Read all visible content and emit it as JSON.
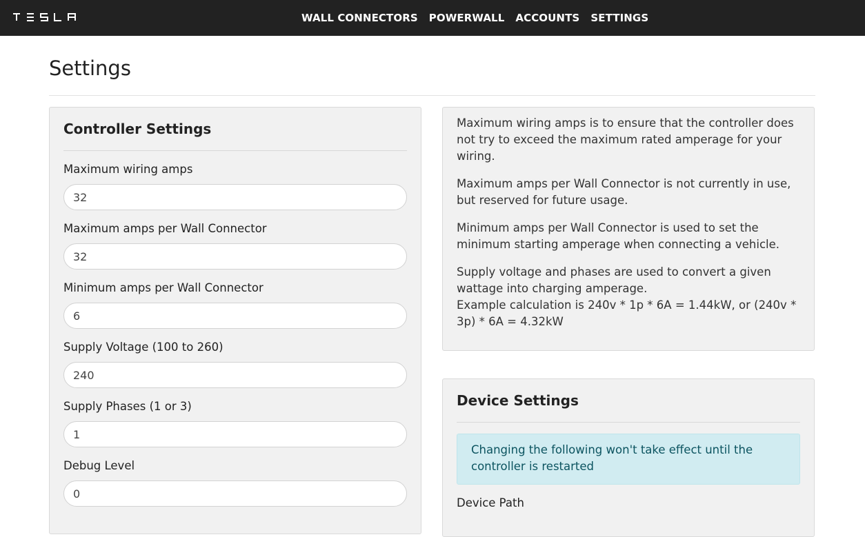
{
  "navbar": {
    "brand": "TESLA",
    "links": [
      "WALL CONNECTORS",
      "POWERWALL",
      "ACCOUNTS",
      "SETTINGS"
    ]
  },
  "page": {
    "title": "Settings"
  },
  "controller": {
    "heading": "Controller Settings",
    "fields": [
      {
        "label": "Maximum wiring amps",
        "value": "32"
      },
      {
        "label": "Maximum amps per Wall Connector",
        "value": "32"
      },
      {
        "label": "Minimum amps per Wall Connector",
        "value": "6"
      },
      {
        "label": "Supply Voltage (100 to 260)",
        "value": "240"
      },
      {
        "label": "Supply Phases (1 or 3)",
        "value": "1"
      },
      {
        "label": "Debug Level",
        "value": "0"
      }
    ]
  },
  "help": {
    "paragraphs": [
      "Maximum wiring amps is to ensure that the controller does not try to exceed the maximum rated amperage for your wiring.",
      "Maximum amps per Wall Connector is not currently in use, but reserved for future usage.",
      "Minimum amps per Wall Connector is used to set the minimum starting amperage when connecting a vehicle.",
      "Supply voltage and phases are used to convert a given wattage into charging amperage.",
      "Example calculation is 240v * 1p * 6A = 1.44kW, or (240v * 3p) * 6A = 4.32kW"
    ]
  },
  "device": {
    "heading": "Device Settings",
    "alert": "Changing the following won't take effect until the controller is restarted",
    "path_label": "Device Path"
  }
}
